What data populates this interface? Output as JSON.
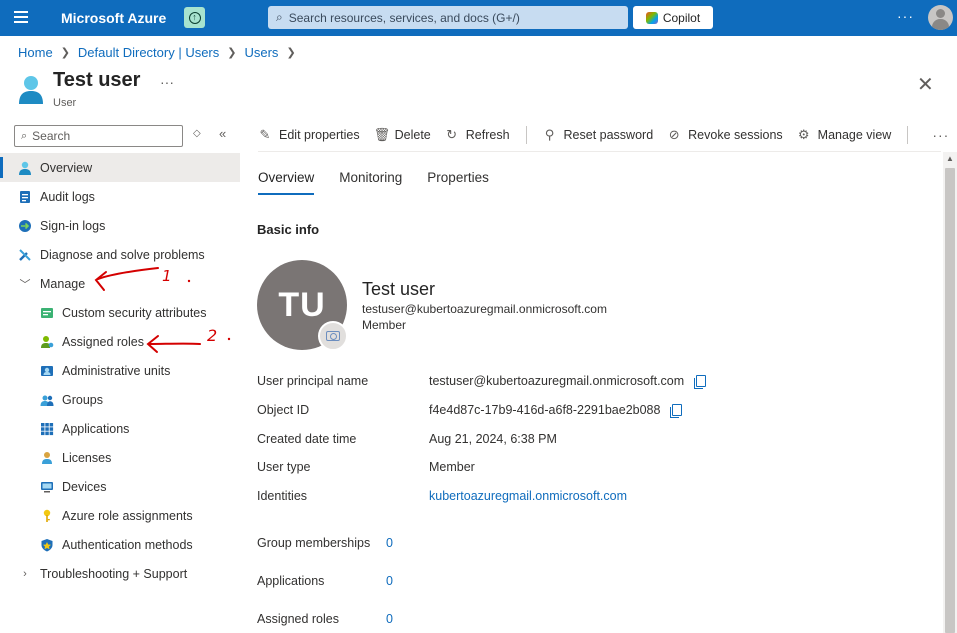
{
  "topbar": {
    "brand": "Microsoft Azure",
    "search_placeholder": "Search resources, services, and docs (G+/)",
    "copilot_label": "Copilot",
    "more": "···"
  },
  "breadcrumb": [
    {
      "label": "Home"
    },
    {
      "label": "Default Directory | Users"
    },
    {
      "label": "Users"
    }
  ],
  "header": {
    "title": "Test user",
    "subtitle": "User",
    "more": "···",
    "close": "✕"
  },
  "sidebar": {
    "search_placeholder": "Search",
    "items": [
      {
        "label": "Overview",
        "icon": "user-icon"
      },
      {
        "label": "Audit logs",
        "icon": "audit-log-icon"
      },
      {
        "label": "Sign-in logs",
        "icon": "sign-in-log-icon"
      },
      {
        "label": "Diagnose and solve problems",
        "icon": "wrench-icon"
      },
      {
        "label": "Manage",
        "icon": "chevron-down-icon"
      },
      {
        "label": "Custom security attributes",
        "icon": "attributes-icon"
      },
      {
        "label": "Assigned roles",
        "icon": "role-icon"
      },
      {
        "label": "Administrative units",
        "icon": "admin-units-icon"
      },
      {
        "label": "Groups",
        "icon": "groups-icon"
      },
      {
        "label": "Applications",
        "icon": "applications-icon"
      },
      {
        "label": "Licenses",
        "icon": "license-icon"
      },
      {
        "label": "Devices",
        "icon": "device-icon"
      },
      {
        "label": "Azure role assignments",
        "icon": "key-icon"
      },
      {
        "label": "Authentication methods",
        "icon": "shield-icon"
      },
      {
        "label": "Troubleshooting + Support",
        "icon": "chevron-right-icon"
      }
    ]
  },
  "toolbar": {
    "edit": "Edit properties",
    "delete": "Delete",
    "refresh": "Refresh",
    "reset_password": "Reset password",
    "revoke_sessions": "Revoke sessions",
    "manage_view": "Manage view",
    "more": "···"
  },
  "tabs": [
    "Overview",
    "Monitoring",
    "Properties"
  ],
  "basic_info": {
    "heading": "Basic info",
    "initials": "TU",
    "name": "Test user",
    "email": "testuser@kubertoazuregmail.onmicrosoft.com",
    "user_type": "Member"
  },
  "properties": [
    {
      "label": "User principal name",
      "value": "testuser@kubertoazuregmail.onmicrosoft.com"
    },
    {
      "label": "Object ID",
      "value": "f4e4d87c-17b9-416d-a6f8-2291bae2b088"
    },
    {
      "label": "Created date time",
      "value": "Aug 21, 2024, 6:38 PM"
    },
    {
      "label": "User type",
      "value": "Member"
    },
    {
      "label": "Identities",
      "value": "kubertoazuregmail.onmicrosoft.com"
    }
  ],
  "counts": [
    {
      "label": "Group memberships",
      "value": "0"
    },
    {
      "label": "Applications",
      "value": "0"
    },
    {
      "label": "Assigned roles",
      "value": "0"
    }
  ],
  "annotations": [
    "1",
    "2"
  ],
  "colors": {
    "accent": "#0f6cbd",
    "annotation": "#d40000"
  }
}
